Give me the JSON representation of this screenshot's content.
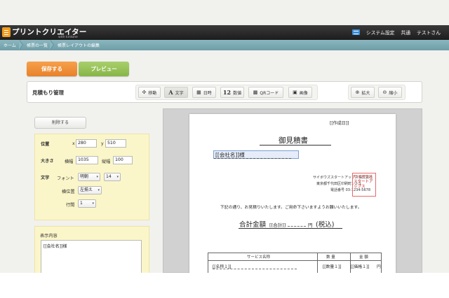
{
  "app": {
    "brand": "プリントクリエイター",
    "brand_sub": "with kintone",
    "top_links": [
      "システム設定",
      "共通",
      "テストさん"
    ]
  },
  "breadcrumb": [
    "ホーム",
    "帳票の一覧",
    "帳票レイアウトの編集"
  ],
  "actions": {
    "save": "保存する",
    "preview": "プレビュー"
  },
  "toolbar": {
    "title": "見積もり管理",
    "tools": [
      {
        "icon": "move-icon",
        "glyph": "✣",
        "label": "移動"
      },
      {
        "icon": "text-icon",
        "glyph": "A",
        "label": "文字"
      },
      {
        "icon": "calendar-icon",
        "glyph": "▦",
        "label": "日時"
      },
      {
        "icon": "number-icon",
        "glyph": "12",
        "label": "数値"
      },
      {
        "icon": "qrcode-icon",
        "glyph": "▩",
        "label": "QRコード"
      },
      {
        "icon": "image-icon",
        "glyph": "▣",
        "label": "画像"
      }
    ],
    "zoom": [
      {
        "icon": "zoom-in-icon",
        "glyph": "⊕",
        "label": "拡大"
      },
      {
        "icon": "zoom-out-icon",
        "glyph": "⊖",
        "label": "縮小"
      }
    ]
  },
  "properties": {
    "delete_label": "削除する",
    "position_label": "位置",
    "x_label": "x",
    "x_value": "280",
    "y_label": "y",
    "y_value": "510",
    "size_label": "大きさ",
    "width_label": "横幅",
    "width_value": "1035",
    "height_label": "縦幅",
    "height_value": "100",
    "text_label": "文字",
    "font_label": "フォント",
    "font_value": "明朝",
    "font_size_value": "14",
    "align_label": "横位置",
    "align_value": "左揃え",
    "line_spacing_label": "行間",
    "line_spacing_value": "1"
  },
  "content": {
    "label": "表示内容",
    "value": "[[会社名]]様"
  },
  "document": {
    "created_date": "[[作成日]]",
    "title": "御見積書",
    "customer": "[[会社名]]様",
    "company_name": "サイボウズスタートアップス株式会社",
    "company_address": "東京都千代田区印刷町1-2-3",
    "company_phone": "電話番号  03-1234-5678",
    "stamp_text": "サイボウズスタートアップス",
    "intro": "下記の通り、お見積りいたします。ご用命下さいますようお願いいたします。",
    "total_label": "合計金額",
    "total_tag": "[[合計]]",
    "yen": "円",
    "tax": "(税込)",
    "table_headers": [
      "サービス名称",
      "数 量",
      "金 額"
    ],
    "row": [
      "[[名称１]]",
      "[[数量１]]",
      "[[価格１]]",
      "円"
    ]
  }
}
